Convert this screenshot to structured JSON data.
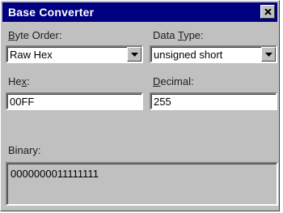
{
  "window": {
    "title": "Base Converter",
    "close_icon": "close-icon"
  },
  "byte_order": {
    "label_prefix": "",
    "label_mnemonic": "B",
    "label_rest": "yte Order:",
    "value": "Raw Hex"
  },
  "data_type": {
    "label_prefix": "Data ",
    "label_mnemonic": "T",
    "label_rest": "ype:",
    "value": "unsigned short"
  },
  "hex": {
    "label_prefix": "He",
    "label_mnemonic": "x",
    "label_rest": ":",
    "value": "00FF"
  },
  "decimal": {
    "label_prefix": "",
    "label_mnemonic": "D",
    "label_rest": "ecimal:",
    "value": "255"
  },
  "binary": {
    "label": "Binary:",
    "value": "0000000011111111"
  }
}
